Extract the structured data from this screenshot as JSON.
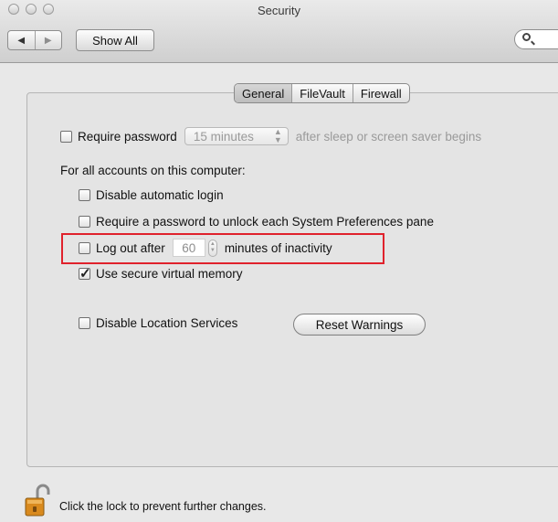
{
  "window": {
    "title": "Security",
    "nav_back_icon": "back-arrow-icon",
    "nav_forward_icon": "forward-arrow-icon",
    "show_all_label": "Show All",
    "search_placeholder": ""
  },
  "tabs": [
    {
      "label": "General",
      "selected": true
    },
    {
      "label": "FileVault",
      "selected": false
    },
    {
      "label": "Firewall",
      "selected": false
    }
  ],
  "general": {
    "require_password": {
      "label": "Require password",
      "checked": false,
      "interval_value": "15 minutes",
      "suffix": "after sleep or screen saver begins"
    },
    "all_accounts_heading": "For all accounts on this computer:",
    "disable_auto_login": {
      "label": "Disable automatic login",
      "checked": false
    },
    "require_pref_password": {
      "label": "Require a password to unlock each System Preferences pane",
      "checked": false
    },
    "logout": {
      "prefix": "Log out after",
      "minutes_value": "60",
      "suffix": "minutes of inactivity",
      "checked": false
    },
    "secure_vm": {
      "label": "Use secure virtual memory",
      "checked": true
    },
    "disable_location": {
      "label": "Disable Location Services",
      "checked": false
    },
    "reset_warnings_label": "Reset Warnings"
  },
  "footer": {
    "lock_icon": "unlocked-padlock-icon",
    "lock_text": "Click the lock to prevent further changes."
  },
  "colors": {
    "highlight_border": "#e0222c",
    "window_bg": "#e8e8e8"
  }
}
